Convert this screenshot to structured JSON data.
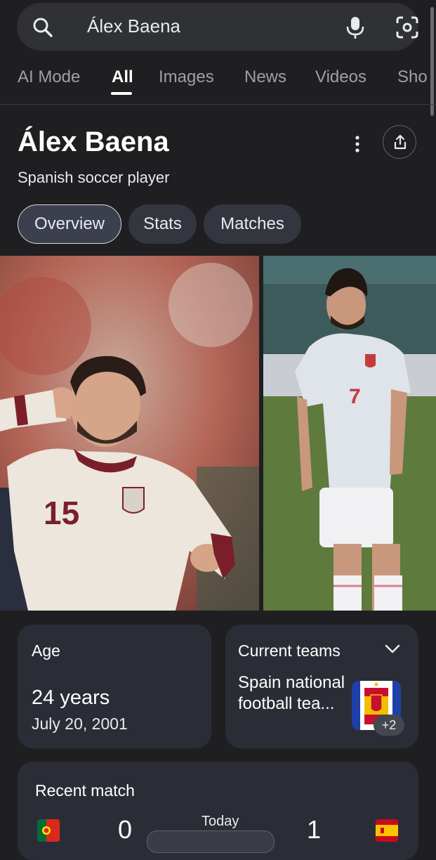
{
  "search": {
    "query": "Álex Baena"
  },
  "tabs": [
    "AI Mode",
    "All",
    "Images",
    "News",
    "Videos",
    "Sho"
  ],
  "entity": {
    "name": "Álex Baena",
    "description": "Spanish soccer player"
  },
  "chips": [
    "Overview",
    "Stats",
    "Matches"
  ],
  "photos": {
    "left_jersey_number": "15",
    "right_jersey_number": "7"
  },
  "age_card": {
    "label": "Age",
    "value": "24 years",
    "birth_date": "July 20, 2001"
  },
  "teams_card": {
    "label": "Current teams",
    "team_name": "Spain national football tea...",
    "more_count": "+2"
  },
  "match_card": {
    "label": "Recent match",
    "home_score": "0",
    "away_score": "1",
    "date": "Today"
  },
  "colors": {
    "background": "#1f1f22",
    "card": "#2b2d36",
    "accent": "#8ab4f8"
  },
  "icons": [
    "search-icon",
    "mic-icon",
    "lens-icon",
    "more-vert-icon",
    "share-icon",
    "chevron-down-icon"
  ]
}
